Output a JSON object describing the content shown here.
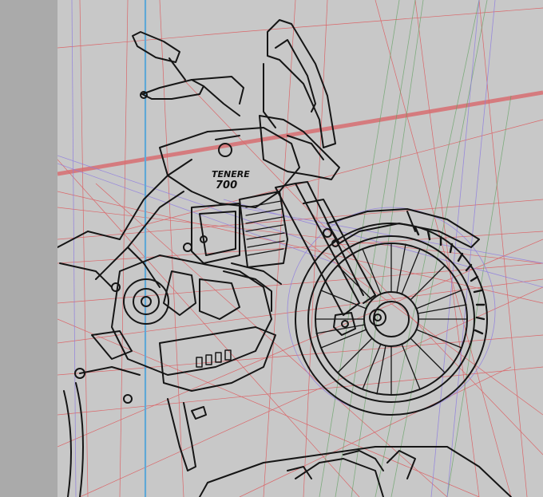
{
  "document": {
    "logo_line1": "TENERE",
    "logo_line2": "700"
  },
  "colors": {
    "canvas_bg": "#c8c8c8",
    "side_panel": "#aaaaaa",
    "line_art": "#151515",
    "perspective_red": "#e0464a",
    "horizon_red": "#d9696c",
    "guide_blue": "#5fa8d6",
    "guide_violet": "#8c7ae0",
    "guide_green": "#5fa05f"
  },
  "icons": {
    "mirror": "mirror-icon"
  }
}
